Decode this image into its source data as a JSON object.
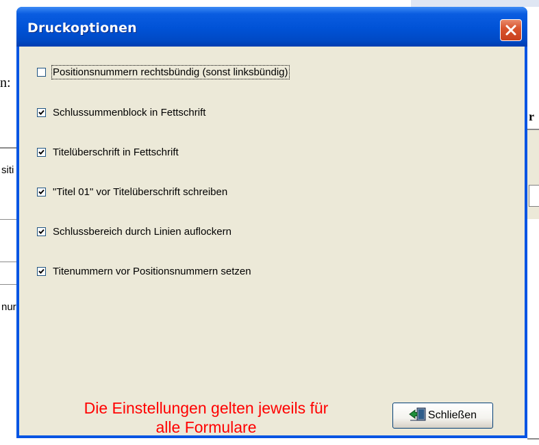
{
  "background": {
    "fragment_n": "n:",
    "fragment_sit": "siti",
    "fragment_nur": "nur",
    "fragment_r": "r"
  },
  "dialog": {
    "title": "Druckoptionen",
    "options": [
      {
        "label": "Positionsnummern rechtsbündig (sonst linksbündig)",
        "checked": false,
        "focused": true
      },
      {
        "label": "Schlussummenblock in Fettschrift",
        "checked": true
      },
      {
        "label": "Titelüberschrift in Fettschrift",
        "checked": true
      },
      {
        "label": "\"Titel 01\" vor Titelüberschrift schreiben",
        "checked": true
      },
      {
        "label": "Schlussbereich durch Linien auflockern",
        "checked": true
      },
      {
        "label": "Titenummern vor Positionsnummern setzen",
        "checked": true
      }
    ],
    "notice_line1": "Die Einstellungen gelten jeweils für",
    "notice_line2": "alle Formulare",
    "close_button_label": "Schließen",
    "close_icon": "close-x-icon",
    "door_icon": "exit-door-icon",
    "colors": {
      "titlebar": "#0054e3",
      "client": "#ece9d8",
      "notice": "#ff0000",
      "close": "#d9552f"
    }
  }
}
